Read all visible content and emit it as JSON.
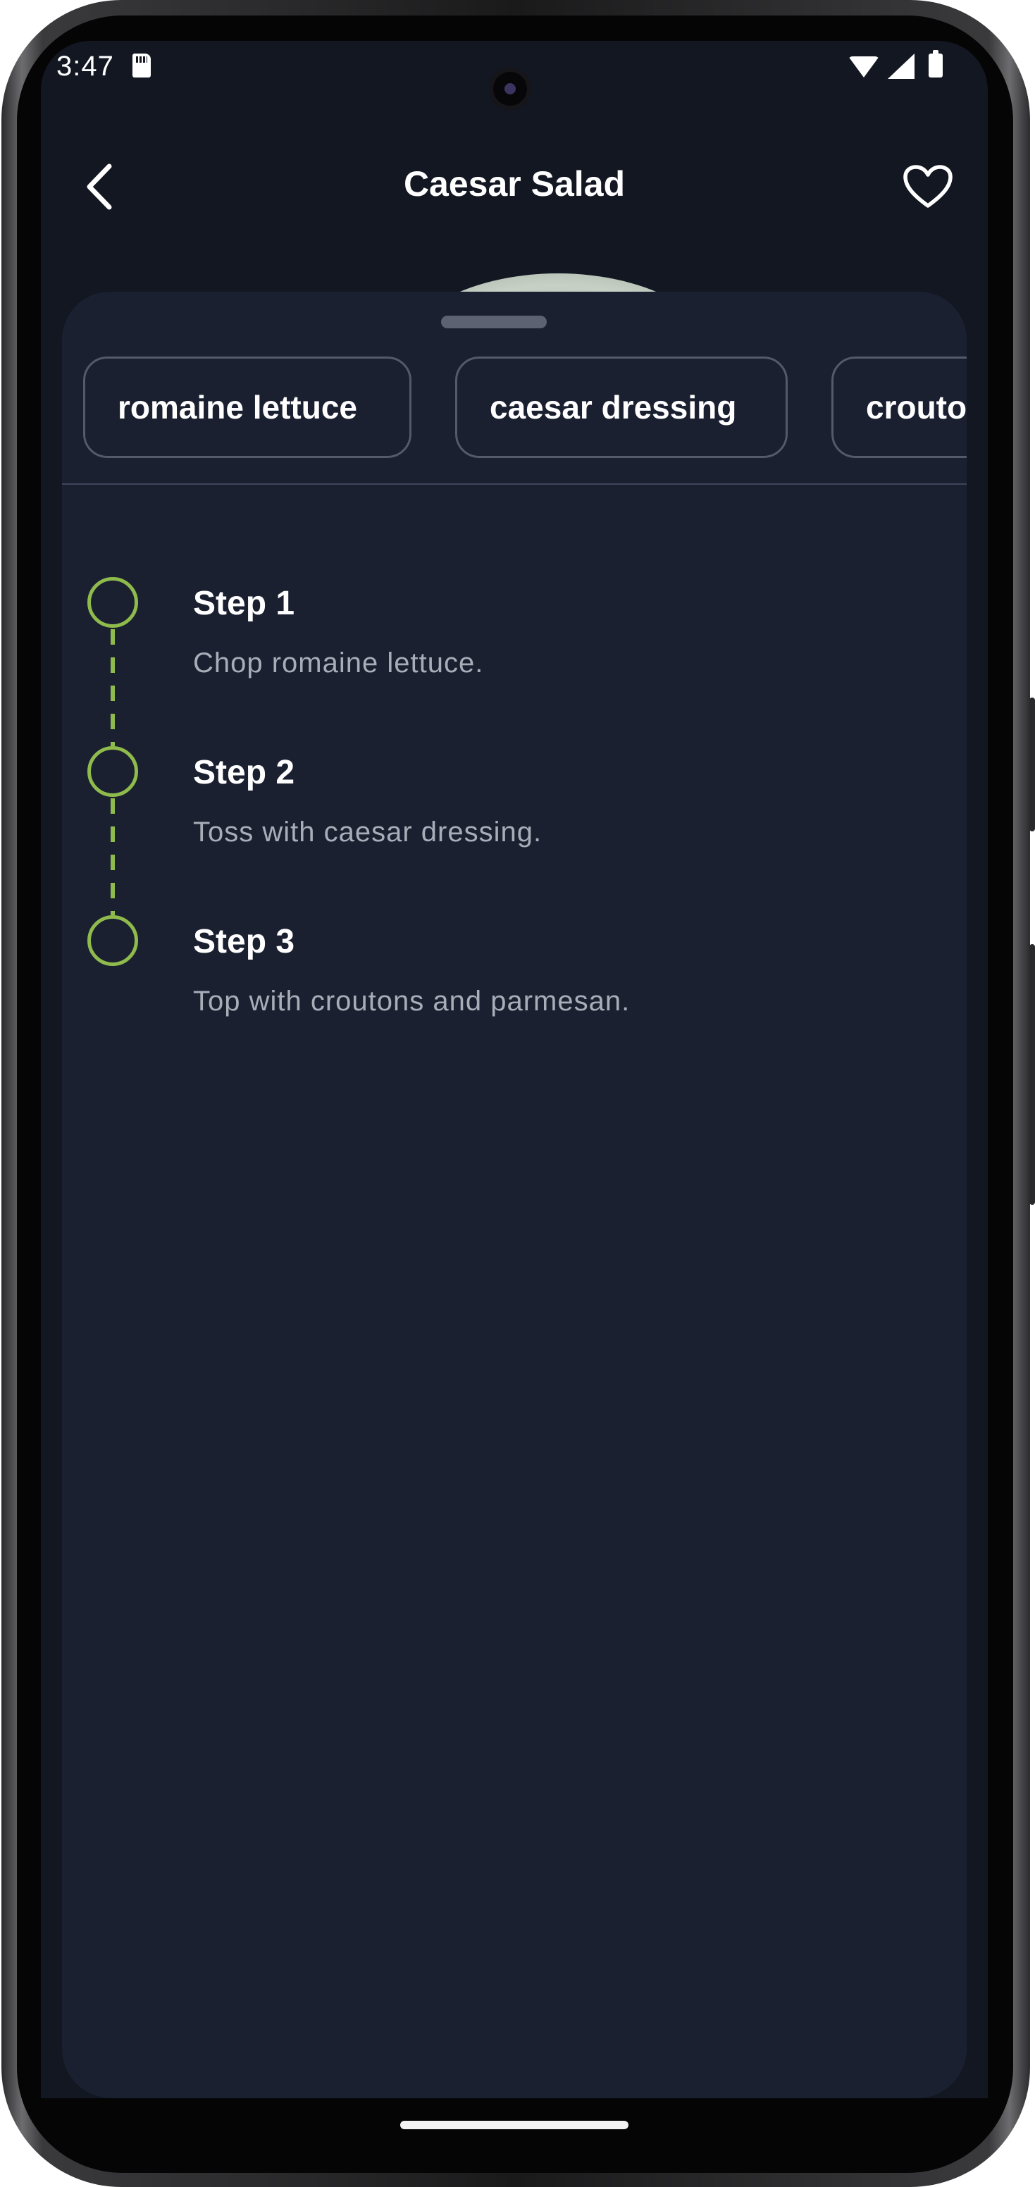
{
  "status_bar": {
    "time": "3:47",
    "icons": [
      "sd-card-icon",
      "wifi-icon",
      "cell-signal-icon",
      "battery-icon"
    ]
  },
  "app_bar": {
    "title": "Caesar Salad",
    "back_icon": "chevron-left-icon",
    "favorite_icon": "heart-outline-icon"
  },
  "ingredients": [
    {
      "label": "romaine lettuce"
    },
    {
      "label": "caesar dressing"
    },
    {
      "label": "croutons"
    }
  ],
  "steps": [
    {
      "title": "Step 1",
      "description": "Chop romaine lettuce."
    },
    {
      "title": "Step 2",
      "description": "Toss with caesar dressing."
    },
    {
      "title": "Step 3",
      "description": "Top with croutons and parmesan."
    }
  ],
  "colors": {
    "background": "#121722",
    "sheet": "#1b2031",
    "accent": "#8ebb4b",
    "chip_border": "#525a6c",
    "secondary_text": "#a9adb8"
  }
}
